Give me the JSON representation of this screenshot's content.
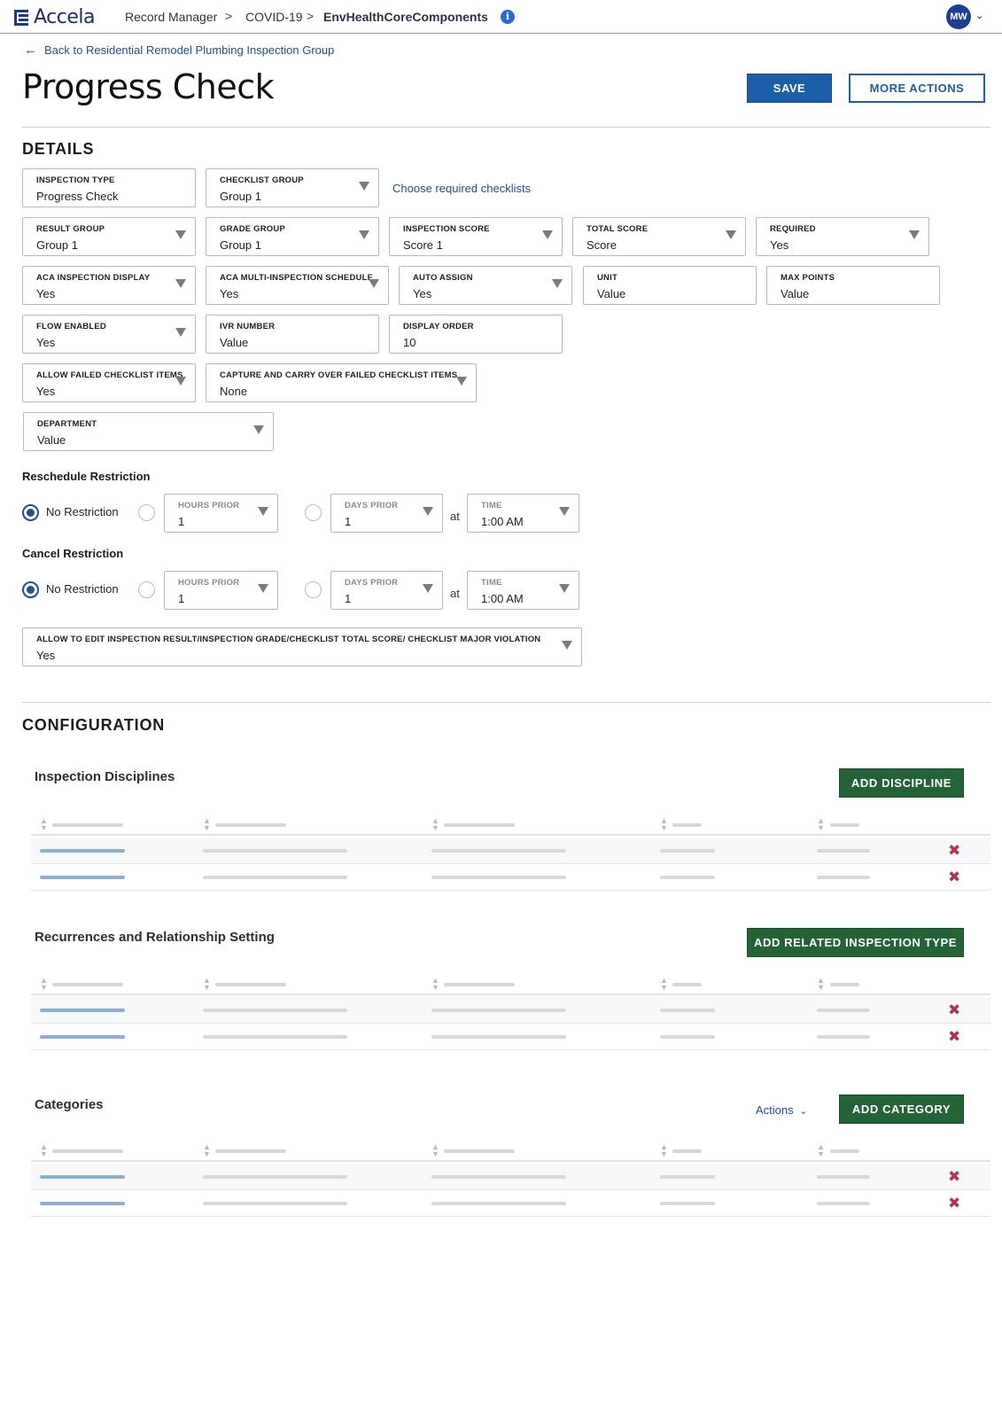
{
  "header": {
    "logo_text": "Accela",
    "breadcrumb": [
      "Record Manager",
      "COVID-19",
      "EnvHealthCoreComponents"
    ],
    "breadcrumb_separator": ">",
    "info_icon": "i",
    "avatar_initials": "MW"
  },
  "back_link": "Back to Residential Remodel Plumbing Inspection Group",
  "page_title": "Progress Check",
  "buttons": {
    "save": "SAVE",
    "more_actions": "MORE ACTIONS"
  },
  "details": {
    "title": "DETAILS",
    "inspection_type": {
      "label": "INSPECTION TYPE",
      "value": "Progress Check"
    },
    "checklist_group": {
      "label": "CHECKLIST GROUP",
      "value": "Group 1"
    },
    "choose_checklists_link": "Choose required checklists",
    "result_group": {
      "label": "RESULT GROUP",
      "value": "Group 1"
    },
    "grade_group": {
      "label": "GRADE GROUP",
      "value": "Group 1"
    },
    "inspection_score": {
      "label": "INSPECTION SCORE",
      "value": "Score 1"
    },
    "total_score": {
      "label": "TOTAL SCORE",
      "value": "Score"
    },
    "required": {
      "label": "REQUIRED",
      "value": "Yes"
    },
    "aca_inspection_display": {
      "label": "ACA INSPECTION DISPLAY",
      "value": "Yes"
    },
    "aca_multi_schedule": {
      "label": "ACA MULTI-INSPECTION SCHEDULE",
      "value": "Yes"
    },
    "auto_assign": {
      "label": "AUTO ASSIGN",
      "value": "Yes"
    },
    "unit": {
      "label": "UNIT",
      "value": "Value"
    },
    "max_points": {
      "label": "MAX POINTS",
      "value": "Value"
    },
    "flow_enabled": {
      "label": "FLOW ENABLED",
      "value": "Yes"
    },
    "ivr_number": {
      "label": "IVR NUMBER",
      "value": "Value"
    },
    "display_order": {
      "label": "DISPLAY ORDER",
      "value": "10"
    },
    "allow_failed_items": {
      "label": "ALLOW FAILED CHECKLIST ITEMS",
      "value": "Yes"
    },
    "capture_carry_over": {
      "label": "CAPTURE AND CARRY OVER FAILED CHECKLIST ITEMS",
      "value": "None"
    },
    "department": {
      "label": "DEPARTMENT",
      "value": "Value"
    },
    "reschedule": {
      "title": "Reschedule Restriction",
      "no_restriction": "No Restriction",
      "hours_prior": {
        "label": "HOURS PRIOR",
        "value": "1"
      },
      "days_prior": {
        "label": "DAYS PRIOR",
        "value": "1"
      },
      "at": "at",
      "time": {
        "label": "TIME",
        "value": "1:00 AM"
      }
    },
    "cancel": {
      "title": "Cancel Restriction",
      "no_restriction": "No Restriction",
      "hours_prior": {
        "label": "HOURS PRIOR",
        "value": "1"
      },
      "days_prior": {
        "label": "DAYS PRIOR",
        "value": "1"
      },
      "at": "at",
      "time": {
        "label": "TIME",
        "value": "1:00 AM"
      }
    },
    "allow_edit": {
      "label": "ALLOW TO EDIT INSPECTION RESULT/INSPECTION GRADE/CHECKLIST TOTAL SCORE/ CHECKLIST MAJOR VIOLATION",
      "value": "Yes"
    }
  },
  "configuration": {
    "title": "CONFIGURATION",
    "disciplines": {
      "title": "Inspection Disciplines",
      "button": "ADD DISCIPLINE"
    },
    "recurrences": {
      "title": "Recurrences and Relationship Setting",
      "button": "ADD RELATED INSPECTION TYPE"
    },
    "categories": {
      "title": "Categories",
      "actions": "Actions",
      "button": "ADD CATEGORY"
    }
  },
  "icons": {
    "logo": "accela-logo-icon",
    "info": "info-icon",
    "chevron": "chevron-down-icon",
    "back": "arrow-left-icon",
    "sort": "sort-icon",
    "delete": "delete-x-icon",
    "dropdown": "caret-down-icon"
  },
  "colors": {
    "primary_blue": "#1d5ea8",
    "link_blue": "#1d4f91",
    "brand_navy": "#1a2e6e",
    "green_button": "#236336",
    "delete_red": "#b1364b"
  }
}
